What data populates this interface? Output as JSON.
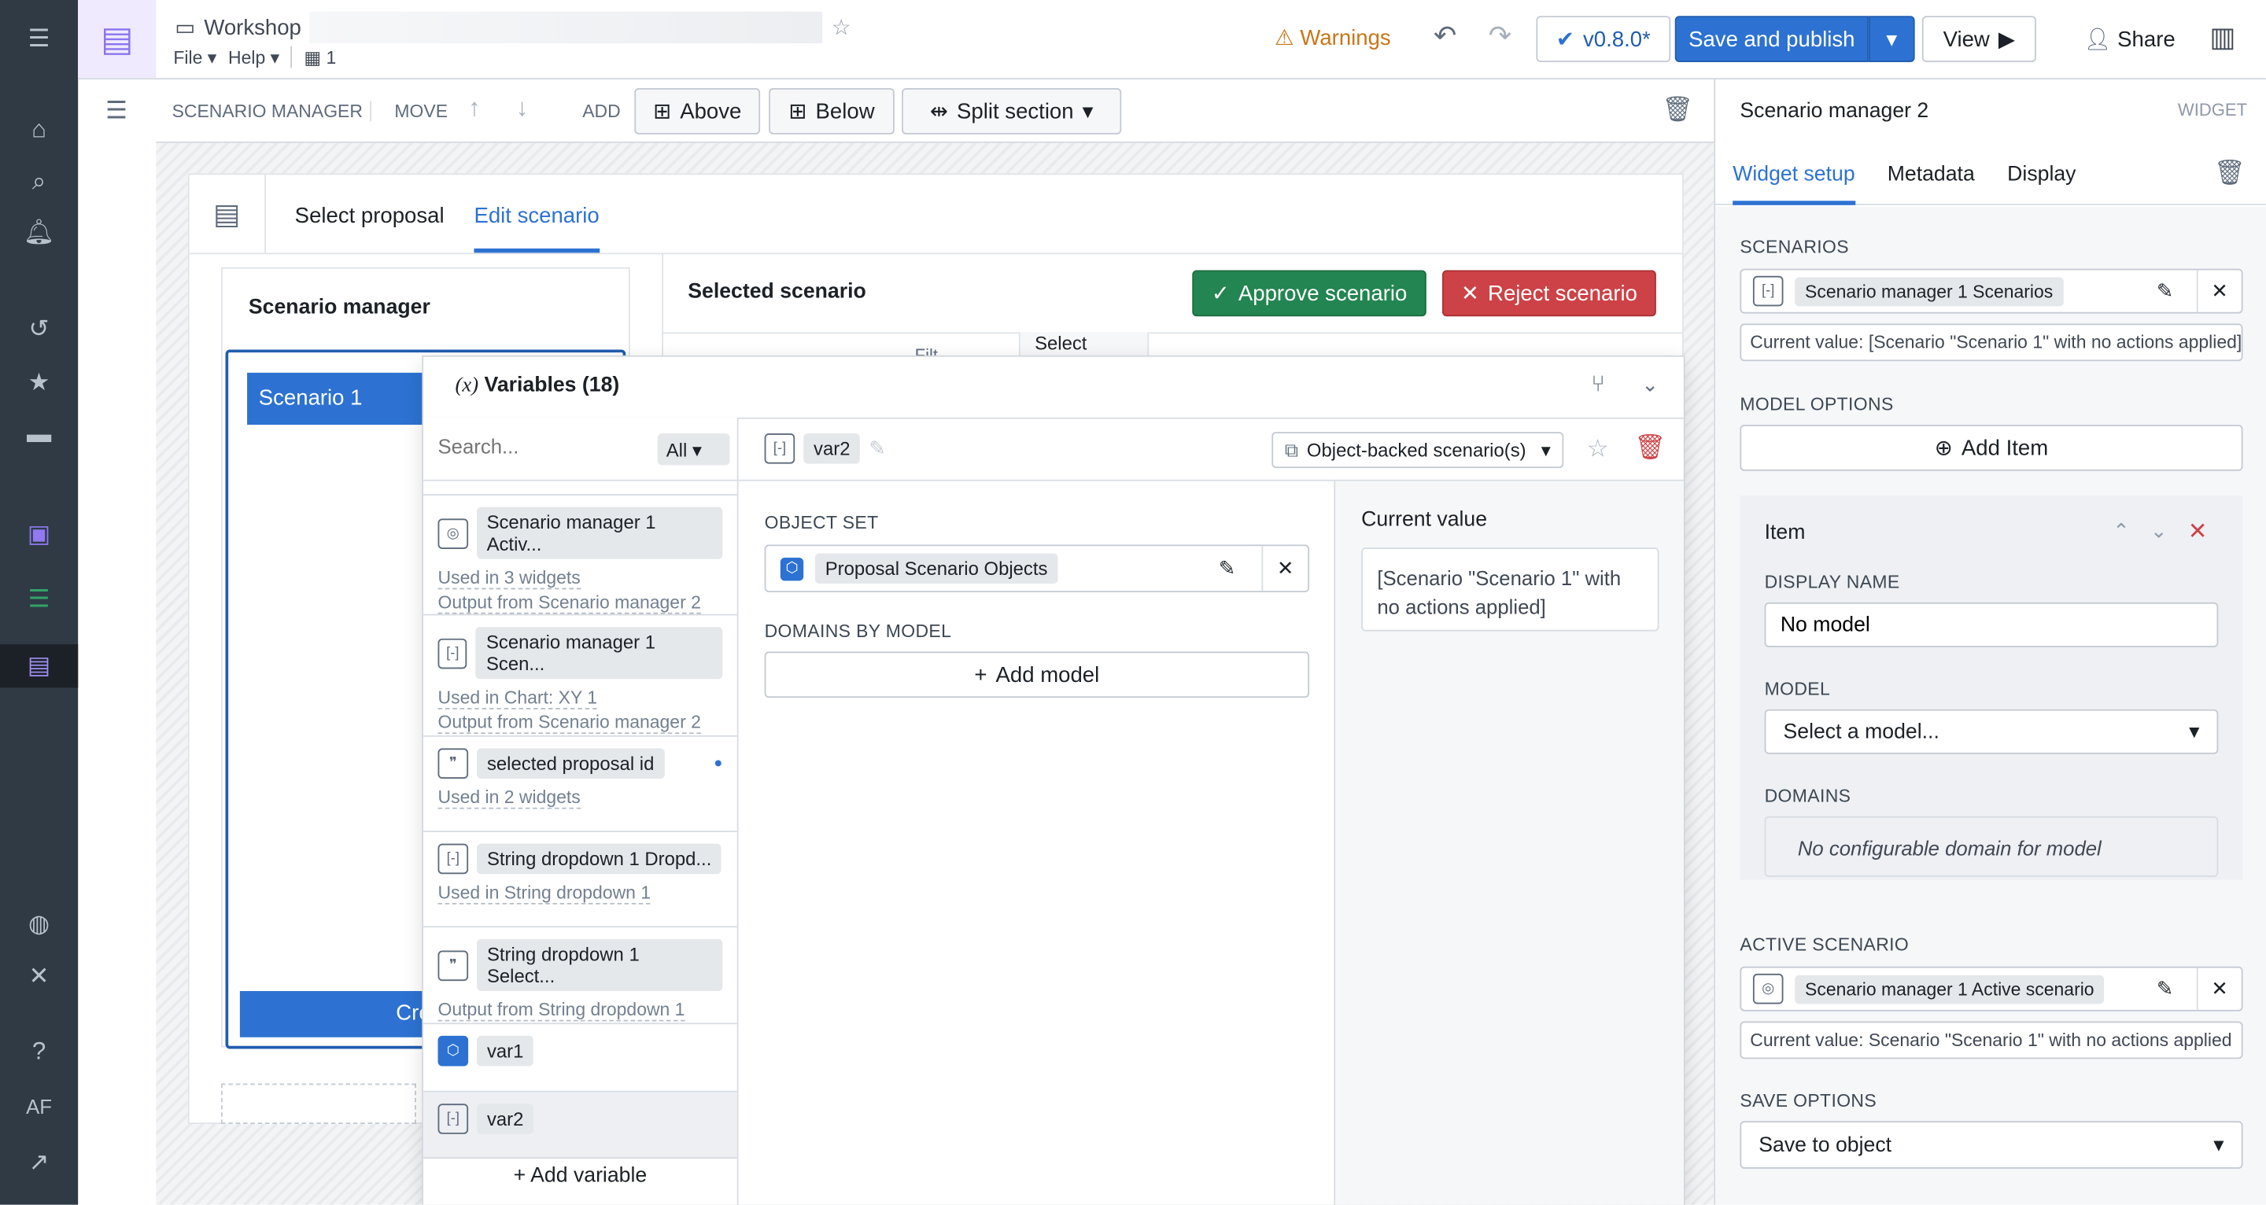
{
  "header": {
    "app": "Workshop",
    "menus": [
      "File",
      "Help"
    ],
    "page_count": "1",
    "warnings": "Warnings",
    "version": "v0.8.0*",
    "save_publish": "Save and publish",
    "view": "View",
    "share": "Share"
  },
  "toolbar": {
    "section": "SCENARIO MANAGER",
    "move": "MOVE",
    "add": "ADD",
    "above": "Above",
    "below": "Below",
    "split": "Split section"
  },
  "widget": {
    "tabs": [
      "Select proposal",
      "Edit scenario"
    ],
    "active_tab": "Edit scenario",
    "manager_title": "Scenario manager",
    "scenario_item": "Scenario 1",
    "create_btn": "Cre",
    "selected_title": "Selected scenario",
    "approve": "Approve scenario",
    "reject": "Reject scenario",
    "col1": "Filt",
    "col2": "Select"
  },
  "variables": {
    "title": "Variables (18)",
    "search_placeholder": "Search...",
    "filter": "All",
    "add_variable": "Add variable",
    "items": [
      {
        "name": "Scenario manager 1 Activ...",
        "icon": "scenario-icon",
        "lines": [
          "Used in 3 widgets",
          "Output from Scenario manager 2"
        ]
      },
      {
        "name": "Scenario manager 1 Scen...",
        "icon": "array-icon",
        "lines": [
          "Used in Chart: XY 1",
          "Output from Scenario manager 2"
        ]
      },
      {
        "name": "selected proposal id",
        "icon": "quote-icon",
        "lines": [
          "Used in 2 widgets"
        ]
      },
      {
        "name": "String dropdown 1 Dropd...",
        "icon": "array-icon",
        "lines": [
          "Used in String dropdown 1"
        ]
      },
      {
        "name": "String dropdown 1 Select...",
        "icon": "quote-icon",
        "lines": [
          "Output from String dropdown 1"
        ]
      },
      {
        "name": "var1",
        "icon": "object-icon",
        "lines": []
      },
      {
        "name": "var2",
        "icon": "array-icon",
        "lines": []
      }
    ],
    "detail": {
      "name": "var2",
      "type": "Object-backed scenario(s)",
      "object_set_label": "OBJECT SET",
      "object_set": "Proposal Scenario Objects",
      "domains_label": "DOMAINS BY MODEL",
      "add_model": "Add model",
      "current_value_label": "Current value",
      "current_value": "[Scenario \"Scenario 1\" with no actions applied]"
    }
  },
  "right_panel": {
    "title": "Scenario manager 2",
    "kind": "WIDGET",
    "tabs": [
      "Widget setup",
      "Metadata",
      "Display"
    ],
    "active_tab": "Widget setup",
    "scenarios_label": "SCENARIOS",
    "scenarios_value": "Scenario manager 1 Scenarios",
    "scenarios_current": "Current value:   [Scenario \"Scenario 1\" with no actions applied]",
    "model_options_label": "MODEL OPTIONS",
    "add_item": "Add Item",
    "item": {
      "title": "Item",
      "display_name_label": "DISPLAY NAME",
      "display_name": "No model",
      "model_label": "MODEL",
      "model_placeholder": "Select a model...",
      "domains_label": "DOMAINS",
      "domains_text": "No configurable domain for model"
    },
    "active_label": "ACTIVE SCENARIO",
    "active_value": "Scenario manager 1 Active scenario",
    "active_current": "Current value:   Scenario \"Scenario 1\" with no actions applied",
    "save_label": "SAVE OPTIONS",
    "save_value": "Save to object"
  },
  "colors": {
    "accent": "#2d72d2",
    "approve": "#238551",
    "reject": "#cd4246",
    "sidebar": "#2f3a45",
    "warning": "#c87619"
  }
}
